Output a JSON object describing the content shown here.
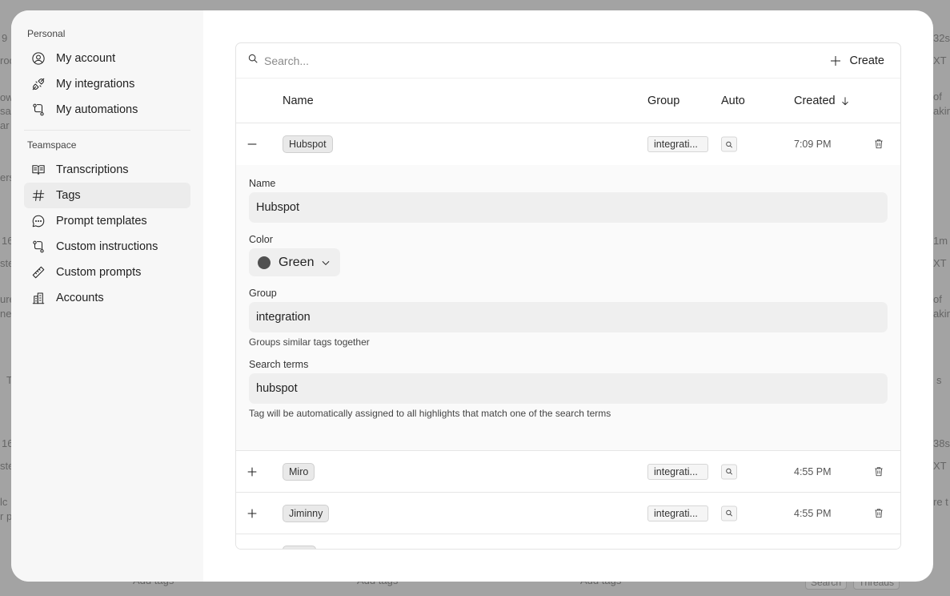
{
  "background": {
    "fragments": [
      "9",
      "roo",
      "ow",
      "sa",
      "ar",
      "ers",
      "16",
      "ste",
      "ure",
      "ne",
      "16",
      "ste",
      "lc",
      "r p",
      "T",
      "32s",
      "XT P",
      "of",
      "akin",
      "1m",
      "XT P",
      "of",
      "akin",
      "s",
      "38s",
      "XT P",
      "re t"
    ],
    "chips": [
      "Add tags",
      "Add tags",
      "Add tags",
      "Search",
      "Threads"
    ]
  },
  "sidebar": {
    "personal_label": "Personal",
    "personal_items": [
      {
        "label": "My account",
        "icon": "user-circle-icon"
      },
      {
        "label": "My integrations",
        "icon": "plug-icon"
      },
      {
        "label": "My automations",
        "icon": "git-flow-icon"
      }
    ],
    "teamspace_label": "Teamspace",
    "teamspace_items": [
      {
        "label": "Transcriptions",
        "icon": "book-open-icon"
      },
      {
        "label": "Tags",
        "icon": "hash-icon",
        "active": true
      },
      {
        "label": "Prompt templates",
        "icon": "chat-bubble-icon"
      },
      {
        "label": "Custom instructions",
        "icon": "git-flow-icon"
      },
      {
        "label": "Custom prompts",
        "icon": "ruler-icon"
      },
      {
        "label": "Accounts",
        "icon": "building-icon"
      }
    ]
  },
  "toolbar": {
    "search_placeholder": "Search...",
    "create_label": "Create"
  },
  "table": {
    "headers": {
      "name": "Name",
      "group": "Group",
      "auto": "Auto",
      "created": "Created"
    },
    "rows": [
      {
        "name": "Hubspot",
        "group": "integrati...",
        "time": "7:09 PM",
        "expanded": true
      },
      {
        "name": "Miro",
        "group": "integrati...",
        "time": "4:55 PM",
        "expanded": false
      },
      {
        "name": "Jiminny",
        "group": "integrati...",
        "time": "4:55 PM",
        "expanded": false
      }
    ]
  },
  "editor": {
    "name_label": "Name",
    "name_value": "Hubspot",
    "color_label": "Color",
    "color_value": "Green",
    "color_swatch": "#505050",
    "group_label": "Group",
    "group_value": "integration",
    "group_help": "Groups similar tags together",
    "terms_label": "Search terms",
    "terms_value": "hubspot",
    "terms_help": "Tag will be automatically assigned to all highlights that match one of the search terms"
  }
}
